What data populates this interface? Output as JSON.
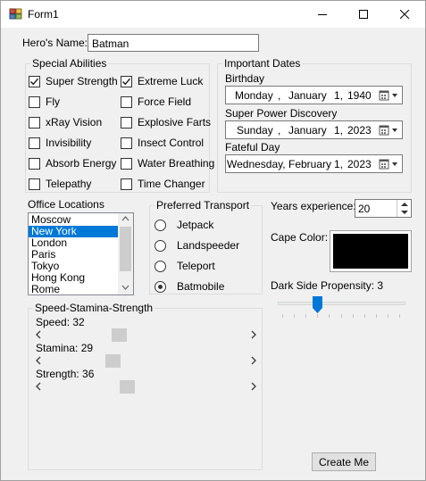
{
  "window": {
    "title": "Form1"
  },
  "hero": {
    "label": "Hero's Name:",
    "value": "Batman"
  },
  "abilities": {
    "title": "Special Abilities",
    "items": [
      {
        "label": "Super Strength",
        "checked": true
      },
      {
        "label": "Fly",
        "checked": false
      },
      {
        "label": "xRay Vision",
        "checked": false
      },
      {
        "label": "Invisibility",
        "checked": false
      },
      {
        "label": "Absorb Energy",
        "checked": false
      },
      {
        "label": "Telepathy",
        "checked": false
      },
      {
        "label": "Extreme Luck",
        "checked": true
      },
      {
        "label": "Force Field",
        "checked": false
      },
      {
        "label": "Explosive Farts",
        "checked": false
      },
      {
        "label": "Insect Control",
        "checked": false
      },
      {
        "label": "Water Breathing",
        "checked": false
      },
      {
        "label": "Time Changer",
        "checked": false
      }
    ]
  },
  "dates": {
    "title": "Important Dates",
    "fields": [
      {
        "label": "Birthday",
        "weekday": "Monday",
        "month": "January",
        "day": "1,",
        "year": "1940"
      },
      {
        "label": "Super Power Discovery",
        "weekday": "Sunday",
        "month": "January",
        "day": "1,",
        "year": "2023"
      },
      {
        "label": "Fateful Day",
        "weekday": "Wednesday,",
        "month": "February",
        "day": "1,",
        "year": "2023"
      }
    ],
    "separator": ","
  },
  "office": {
    "label": "Office Locations",
    "items": [
      "Moscow",
      "New York",
      "London",
      "Paris",
      "Tokyo",
      "Hong Kong",
      "Rome"
    ],
    "selected": "New York"
  },
  "transport": {
    "title": "Preferred Transport",
    "options": [
      {
        "label": "Jetpack",
        "selected": false
      },
      {
        "label": "Landspeeder",
        "selected": false
      },
      {
        "label": "Teleport",
        "selected": false
      },
      {
        "label": "Batmobile",
        "selected": true
      }
    ]
  },
  "experience": {
    "label": "Years experience:",
    "value": "20"
  },
  "cape": {
    "label": "Cape Color:",
    "color": "#000000"
  },
  "darkside": {
    "label": "Dark Side Propensity: 3",
    "value": 3,
    "min": 0,
    "max": 10
  },
  "sss": {
    "title": "Speed-Stamina-Strength",
    "bars": [
      {
        "label": "Speed: 32",
        "value": 32
      },
      {
        "label": "Stamina: 29",
        "value": 29
      },
      {
        "label": "Strength: 36",
        "value": 36
      }
    ],
    "max": 100
  },
  "create_button": "Create Me",
  "colors": {
    "accent": "#0078d7",
    "window_bg": "#f0f0f0"
  }
}
